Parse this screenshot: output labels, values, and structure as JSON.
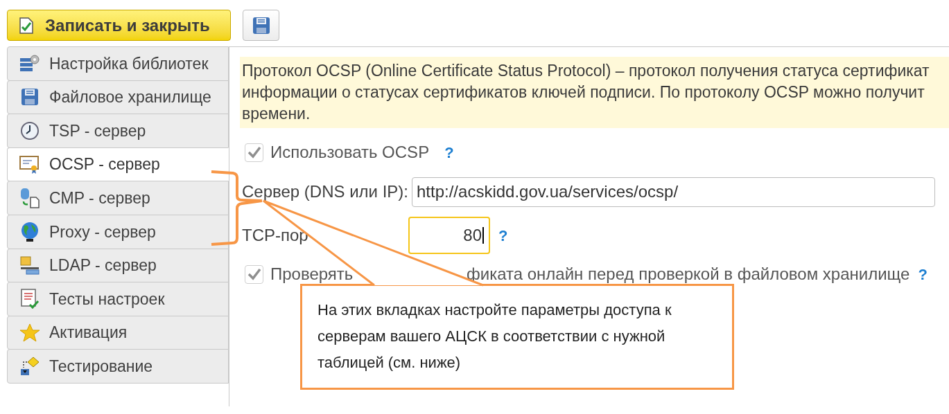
{
  "toolbar": {
    "save_close_button": "Записать и закрыть"
  },
  "tabs": [
    {
      "label": "Настройка библиотек",
      "selected": false
    },
    {
      "label": "Файловое хранилище",
      "selected": false
    },
    {
      "label": "TSP - сервер",
      "selected": false
    },
    {
      "label": "OCSP - сервер",
      "selected": true
    },
    {
      "label": "CMP - сервер",
      "selected": false
    },
    {
      "label": "Proxy - сервер",
      "selected": false
    },
    {
      "label": "LDAP - сервер",
      "selected": false
    },
    {
      "label": "Тесты настроек",
      "selected": false
    },
    {
      "label": "Активация",
      "selected": false
    },
    {
      "label": "Тестирование",
      "selected": false
    }
  ],
  "info_banner": {
    "lines": [
      "Протокол OCSP (Online Certificate Status Protocol) – протокол получения статуса сертификат",
      "информации о статусах сертификатов ключей подписи. По протоколу OCSP можно получит",
      "времени."
    ]
  },
  "use_ocsp": {
    "label": "Использовать OCSP",
    "checked": true,
    "disabled": true,
    "help": "?"
  },
  "server": {
    "label": "Сервер (DNS или IP):",
    "value": "http://acskidd.gov.ua/services/ocsp/"
  },
  "tcp_port": {
    "label": "TCP-пор",
    "value": "80",
    "focused": true,
    "help": "?"
  },
  "check_online": {
    "label_parts": [
      "Проверять",
      "фиката онлайн перед проверкой в файловом хранилище"
    ],
    "checked": true,
    "disabled": true,
    "help": "?"
  },
  "callout": {
    "text": "На этих вкладках настройте параметры доступа к серверам вашего АЦСК в соответствии с нужной таблицей (см. ниже)"
  }
}
